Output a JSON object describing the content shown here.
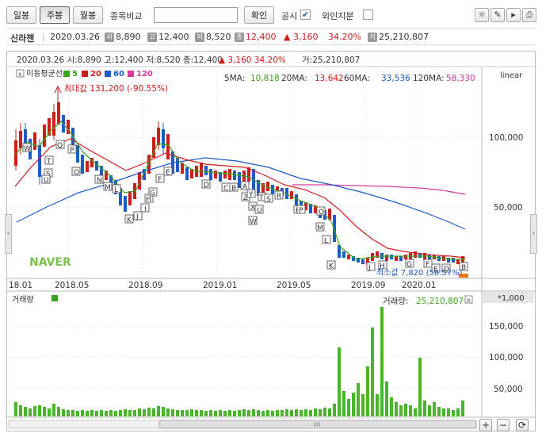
{
  "toolbar": {
    "period_buttons": [
      "일봉",
      "주봉",
      "월봉"
    ],
    "compare_label": "종목비교",
    "confirm_label": "확인",
    "disclosure_label": "공시",
    "foreign_label": "외인지분"
  },
  "info": {
    "name": "신라젠",
    "date": "2020.03.26",
    "open_badge": "시",
    "open": "8,890",
    "high_badge": "고",
    "high": "12,400",
    "low_badge": "저",
    "low": "8,520",
    "close_badge": "종",
    "close": "12,400",
    "change": "▲ 3,160",
    "change_pct": "34.20%",
    "volume_badge": "거",
    "volume": "25,210,807"
  },
  "chart": {
    "header": "2020.03.26 시:8,890 고:12,400 저:8,520 종:12,400",
    "header_change": "▲    3,160  34.20%",
    "header_vol": "거:25,210,807",
    "scale": "linear",
    "ma_title": "이동평균선",
    "ma_legend": [
      {
        "label": "5",
        "color": "#3aa31c"
      },
      {
        "label": "20",
        "color": "#d11c1c"
      },
      {
        "label": "60",
        "color": "#1b5cc7"
      },
      {
        "label": "120",
        "color": "#d73aa1"
      }
    ],
    "ma_values": [
      {
        "label": "5MA:",
        "value": "10,818",
        "color": "#3aa31c"
      },
      {
        "label": "20MA:",
        "value": "13,642",
        "color": "#d11c1c"
      },
      {
        "label": "60MA:",
        "value": "33,536",
        "color": "#1b5cc7"
      },
      {
        "label": "120MA:",
        "value": "58,330",
        "color": "#d73aa1"
      }
    ],
    "max_label": "최대값 131,200 (-90.55%)",
    "min_label": "최소값 7,820 (58.57%)",
    "price_ticks": [
      "100,000",
      "50,000"
    ],
    "date_ticks": [
      "18.01",
      "2018.05",
      "2018.09",
      "2019.01",
      "2019.05",
      "2019.09",
      "2020.01"
    ],
    "watermark": "NAVER",
    "volume_title": "거래량",
    "volume_value_label": "거래량:",
    "volume_value": "25,210,807",
    "volume_unit": "*1,000",
    "volume_ticks": [
      "150,000",
      "100,000",
      "50,000"
    ]
  }
}
